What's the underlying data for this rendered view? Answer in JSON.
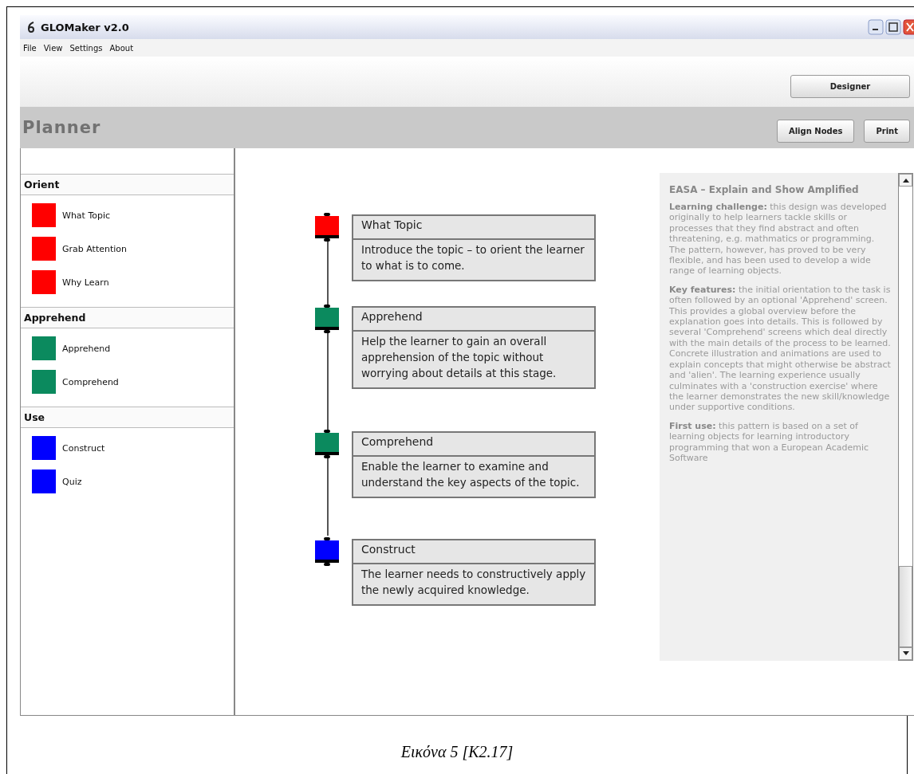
{
  "window": {
    "title": "GLOMaker v2.0"
  },
  "menu": [
    "File",
    "View",
    "Settings",
    "About"
  ],
  "toolbar": {
    "buttons": [
      "Designer"
    ]
  },
  "header": {
    "title": "Planner",
    "buttons": [
      "Align Nodes",
      "Print"
    ]
  },
  "sidebar": {
    "sections": [
      {
        "title": "Orient",
        "items": [
          {
            "label": "What Topic",
            "color": "#ff0000"
          },
          {
            "label": "Grab Attention",
            "color": "#ff0000"
          },
          {
            "label": "Why Learn",
            "color": "#ff0000"
          }
        ]
      },
      {
        "title": "Apprehend",
        "items": [
          {
            "label": "Apprehend",
            "color": "#0b8a5e"
          },
          {
            "label": "Comprehend",
            "color": "#0b8a5e"
          }
        ]
      },
      {
        "title": "Use",
        "items": [
          {
            "label": "Construct",
            "color": "#0000ff"
          },
          {
            "label": "Quiz",
            "color": "#0000ff"
          }
        ]
      }
    ]
  },
  "canvas": {
    "nodes": [
      {
        "title": "What Topic",
        "description": "Introduce the topic – to orient the learner to what is to come.",
        "color": "#ff0000"
      },
      {
        "title": "Apprehend",
        "description": "Help the learner to gain an overall apprehension of the topic without worrying about details at this stage.",
        "color": "#0b8a5e"
      },
      {
        "title": "Comprehend",
        "description": "Enable the learner to examine and understand the key aspects of the topic.",
        "color": "#0b8a5e"
      },
      {
        "title": "Construct",
        "description": "The learner needs to constructively apply the newly acquired knowledge.",
        "color": "#0000ff"
      }
    ]
  },
  "description_panel": {
    "title": "EASA – Explain and Show Amplified",
    "paragraphs": [
      "**Learning challenge:** this design was developed originally to help learners tackle skills or processes that they find abstract and often threatening, e.g. mathmatics or programming. The pattern, however, has proved to be very flexible, and has been used to develop a wide range of learning objects.",
      "**Key features:** the initial orientation to the task is often followed by an optional 'Apprehend' screen. This provides a global overview before the explanation goes into details. This is followed by several 'Comprehend' screens which deal directly with the main details of the process to be learned. Concrete illustration and animations are used to explain concepts that might otherwise be abstract and 'alien'. The learning experience usually culminates with a 'construction exercise' where the learner demonstrates the new skill/knowledge under supportive conditions.",
      "**First use:** this pattern is based on a set of learning objects for learning introductory programming that won a European Academic Software"
    ]
  },
  "caption": "Εικόνα 5 [Κ2.17]"
}
